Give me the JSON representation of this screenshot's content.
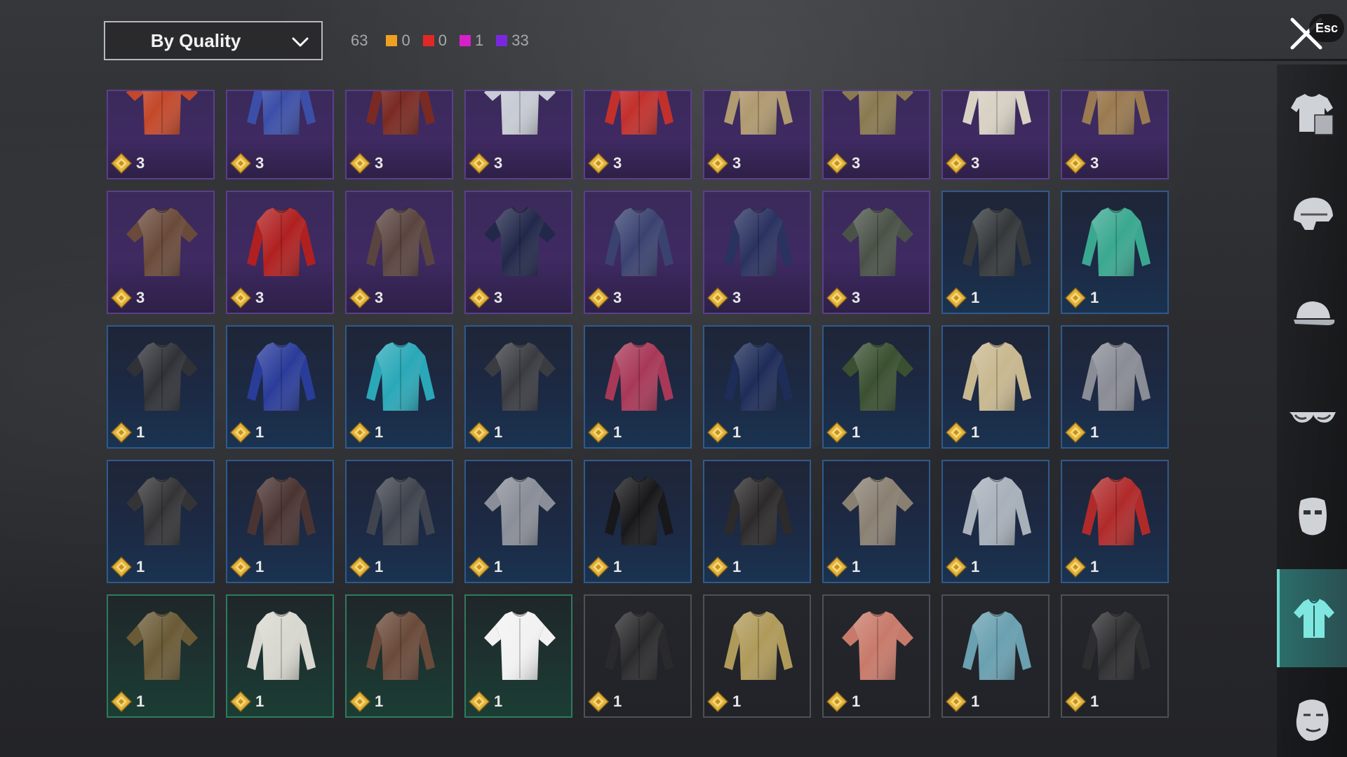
{
  "toolbar": {
    "sort_label": "By Quality",
    "total_count": "63",
    "stats": [
      {
        "color": "#f0a020",
        "count": "0"
      },
      {
        "color": "#e02828",
        "count": "0"
      },
      {
        "color": "#d820c8",
        "count": "1"
      },
      {
        "color": "#7a28e0",
        "count": "33"
      }
    ],
    "esc_label": "Esc"
  },
  "colors": {
    "purple": "#5a3f8a",
    "blue": "#2f5a8c",
    "green": "#2f7a5e",
    "gray": "#4e5058",
    "active_tab": "#2b6e6a"
  },
  "items": [
    {
      "quality": "purple",
      "color": "#c4482a",
      "count": "3"
    },
    {
      "quality": "purple",
      "color": "#3b4fa8",
      "count": "3"
    },
    {
      "quality": "purple",
      "color": "#7a2a22",
      "count": "3"
    },
    {
      "quality": "purple",
      "color": "#c8ccd4",
      "count": "3"
    },
    {
      "quality": "purple",
      "color": "#c2302c",
      "count": "3"
    },
    {
      "quality": "purple",
      "color": "#b09a70",
      "count": "3"
    },
    {
      "quality": "purple",
      "color": "#8a7a50",
      "count": "3"
    },
    {
      "quality": "purple",
      "color": "#d8d2c4",
      "count": "3"
    },
    {
      "quality": "purple",
      "color": "#9a7a50",
      "count": "3"
    },
    {
      "quality": "purple",
      "color": "#6a4a3a",
      "count": "3"
    },
    {
      "quality": "purple",
      "color": "#b02020",
      "count": "3"
    },
    {
      "quality": "purple",
      "color": "#5a4440",
      "count": "3"
    },
    {
      "quality": "purple",
      "color": "#22284a",
      "count": "3"
    },
    {
      "quality": "purple",
      "color": "#3a4270",
      "count": "3"
    },
    {
      "quality": "purple",
      "color": "#2a3260",
      "count": "3"
    },
    {
      "quality": "purple",
      "color": "#4a5248",
      "count": "3"
    },
    {
      "quality": "blue",
      "color": "#34383a",
      "count": "1"
    },
    {
      "quality": "blue",
      "color": "#3aa890",
      "count": "1"
    },
    {
      "quality": "blue",
      "color": "#303238",
      "count": "1"
    },
    {
      "quality": "blue",
      "color": "#2a3c9a",
      "count": "1"
    },
    {
      "quality": "blue",
      "color": "#2aa8b8",
      "count": "1"
    },
    {
      "quality": "blue",
      "color": "#3a3c42",
      "count": "1"
    },
    {
      "quality": "blue",
      "color": "#a83858",
      "count": "1"
    },
    {
      "quality": "blue",
      "color": "#1e2c58",
      "count": "1"
    },
    {
      "quality": "blue",
      "color": "#3a5030",
      "count": "1"
    },
    {
      "quality": "blue",
      "color": "#c8b890",
      "count": "1"
    },
    {
      "quality": "blue",
      "color": "#8a8c96",
      "count": "1"
    },
    {
      "quality": "blue",
      "color": "#343436",
      "count": "1"
    },
    {
      "quality": "blue",
      "color": "#4a3432",
      "count": "1"
    },
    {
      "quality": "blue",
      "color": "#40444e",
      "count": "1"
    },
    {
      "quality": "blue",
      "color": "#8a8e98",
      "count": "1"
    },
    {
      "quality": "blue",
      "color": "#18181a",
      "count": "1"
    },
    {
      "quality": "blue",
      "color": "#2c2a2a",
      "count": "1"
    },
    {
      "quality": "blue",
      "color": "#8a8072",
      "count": "1"
    },
    {
      "quality": "blue",
      "color": "#a8b0ba",
      "count": "1"
    },
    {
      "quality": "blue",
      "color": "#b02a2a",
      "count": "1"
    },
    {
      "quality": "green",
      "color": "#6a5a36",
      "count": "1"
    },
    {
      "quality": "green",
      "color": "#d8d8d0",
      "count": "1"
    },
    {
      "quality": "green",
      "color": "#6a4a3a",
      "count": "1"
    },
    {
      "quality": "green",
      "color": "#f2f2f2",
      "count": "1"
    },
    {
      "quality": "gray",
      "color": "#2a2a2c",
      "count": "1"
    },
    {
      "quality": "gray",
      "color": "#b09a5a",
      "count": "1"
    },
    {
      "quality": "gray",
      "color": "#c87a6a",
      "count": "1"
    },
    {
      "quality": "gray",
      "color": "#6aa0b0",
      "count": "1"
    },
    {
      "quality": "gray",
      "color": "#2e2e30",
      "count": "1"
    }
  ],
  "sidebar": {
    "categories": [
      {
        "icon": "outfit-icon"
      },
      {
        "icon": "helmet-icon"
      },
      {
        "icon": "cap-icon"
      },
      {
        "icon": "glasses-icon"
      },
      {
        "icon": "mask-icon"
      },
      {
        "icon": "shirt-icon",
        "active": true
      },
      {
        "icon": "face-icon"
      }
    ]
  }
}
